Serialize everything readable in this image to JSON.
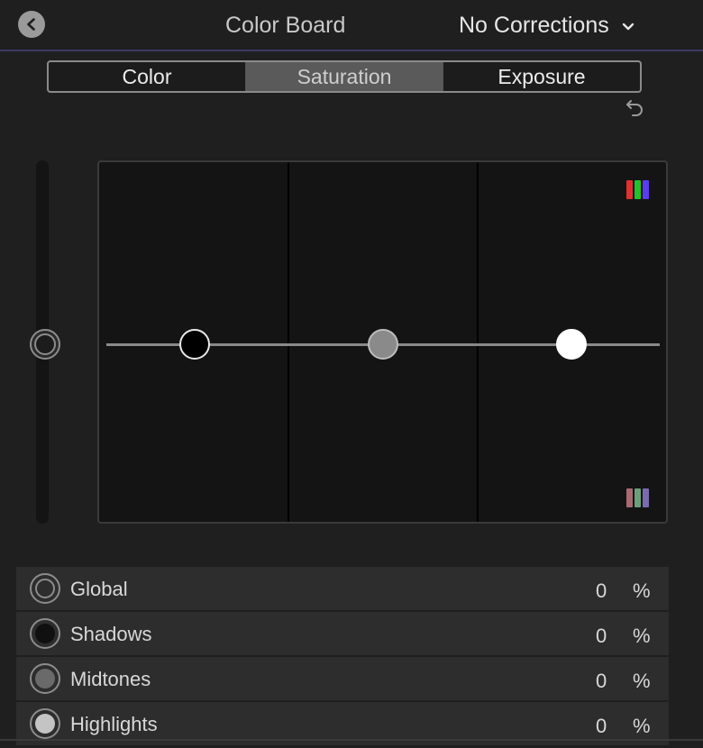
{
  "header": {
    "title": "Color Board",
    "corrections_label": "No Corrections",
    "accent_color": "#3d3a66"
  },
  "tabs": [
    {
      "label": "Color",
      "active": false
    },
    {
      "label": "Saturation",
      "active": true
    },
    {
      "label": "Exposure",
      "active": false
    }
  ],
  "icons": {
    "back": "chevron-left-icon",
    "dropdown": "chevron-down-icon",
    "reset": "undo-arrow-icon"
  },
  "board": {
    "pucks": [
      "shadows",
      "midtones",
      "highlights"
    ],
    "indicator_colors_top": [
      "#e03030",
      "#22c22a",
      "#5a3cf2"
    ],
    "indicator_colors_bottom": [
      "#a86a72",
      "#6aa07a",
      "#7a6ab0"
    ]
  },
  "parameters": [
    {
      "label": "Global",
      "value": "0",
      "unit": "%"
    },
    {
      "label": "Shadows",
      "value": "0",
      "unit": "%"
    },
    {
      "label": "Midtones",
      "value": "0",
      "unit": "%"
    },
    {
      "label": "Highlights",
      "value": "0",
      "unit": "%"
    }
  ]
}
